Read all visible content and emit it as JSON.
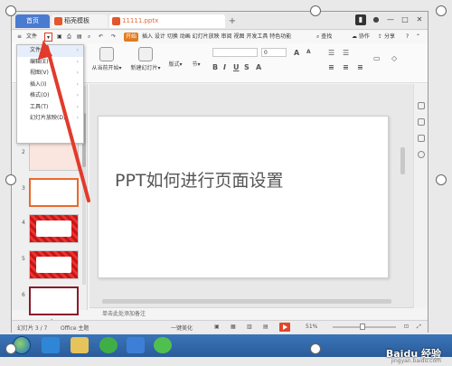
{
  "tabs": {
    "home": "首页",
    "template": "稻壳模板",
    "doc": "11111.pptx"
  },
  "menu": {
    "file": "文件",
    "start": "开始",
    "insert_etc": "插入 设计 切换 动画 幻灯片放映 审阅 视图 开发工具 特色功能",
    "search": "查找",
    "collab": "协作",
    "share": "分享"
  },
  "ribbon": {
    "from_start": "从当前开始▾",
    "new_slide": "新建幻灯片▾",
    "layout": "版式▾",
    "section": "节▾",
    "font_size": "0"
  },
  "dropdown": [
    {
      "label": "文件(F)"
    },
    {
      "label": "编辑(E)"
    },
    {
      "label": "视图(V)"
    },
    {
      "label": "插入(I)"
    },
    {
      "label": "格式(O)"
    },
    {
      "label": "工具(T)"
    },
    {
      "label": "幻灯片放映(D)"
    }
  ],
  "thumbnails": [
    {
      "num": "2"
    },
    {
      "num": "3"
    },
    {
      "num": "4"
    },
    {
      "num": "5"
    },
    {
      "num": "6"
    }
  ],
  "slide": {
    "title": "PPT如何进行页面设置"
  },
  "notes": {
    "placeholder": "单击此处添加备注"
  },
  "status": {
    "slide_pos": "幻灯片 3 / 7",
    "theme": "Office 主题",
    "beautify": "一键美化",
    "zoom": "51%"
  },
  "watermark": {
    "brand": "Baidu 经验",
    "url": "jingyan.baidu.com"
  },
  "colors": {
    "accent": "#4a7bd0",
    "start": "#e07b1f",
    "arrow": "#e23a2b",
    "taskbar": "#2b5c9a"
  }
}
